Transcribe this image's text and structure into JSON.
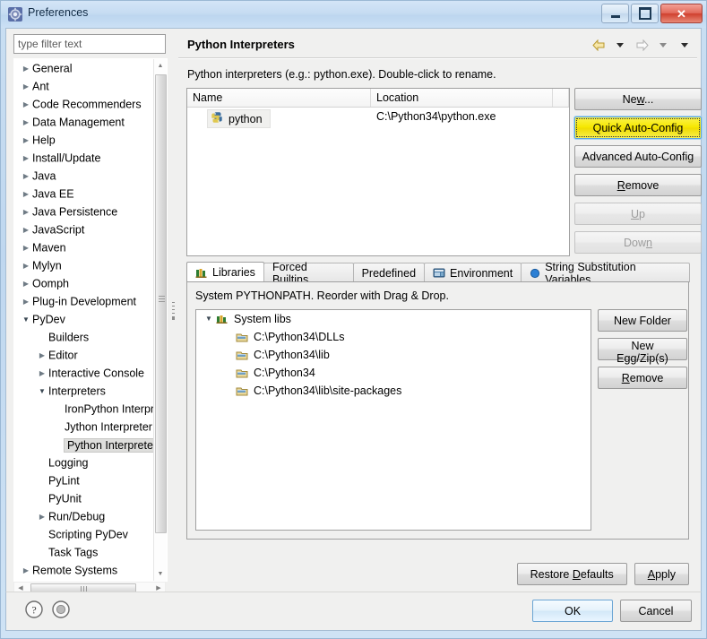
{
  "window": {
    "title": "Preferences",
    "icon": "preferences-gear-icon",
    "controls": {
      "minimize": "minimize-button",
      "maximize": "maximize-button",
      "close": "✕"
    }
  },
  "sidebar": {
    "filter": {
      "placeholder": "type filter text",
      "value": ""
    },
    "items": [
      {
        "label": "General",
        "indent": 0,
        "arrow": "collapsed",
        "selected": false
      },
      {
        "label": "Ant",
        "indent": 0,
        "arrow": "collapsed",
        "selected": false
      },
      {
        "label": "Code Recommenders",
        "indent": 0,
        "arrow": "collapsed",
        "selected": false
      },
      {
        "label": "Data Management",
        "indent": 0,
        "arrow": "collapsed",
        "selected": false
      },
      {
        "label": "Help",
        "indent": 0,
        "arrow": "collapsed",
        "selected": false
      },
      {
        "label": "Install/Update",
        "indent": 0,
        "arrow": "collapsed",
        "selected": false
      },
      {
        "label": "Java",
        "indent": 0,
        "arrow": "collapsed",
        "selected": false
      },
      {
        "label": "Java EE",
        "indent": 0,
        "arrow": "collapsed",
        "selected": false
      },
      {
        "label": "Java Persistence",
        "indent": 0,
        "arrow": "collapsed",
        "selected": false
      },
      {
        "label": "JavaScript",
        "indent": 0,
        "arrow": "collapsed",
        "selected": false
      },
      {
        "label": "Maven",
        "indent": 0,
        "arrow": "collapsed",
        "selected": false
      },
      {
        "label": "Mylyn",
        "indent": 0,
        "arrow": "collapsed",
        "selected": false
      },
      {
        "label": "Oomph",
        "indent": 0,
        "arrow": "collapsed",
        "selected": false
      },
      {
        "label": "Plug-in Development",
        "indent": 0,
        "arrow": "collapsed",
        "selected": false
      },
      {
        "label": "PyDev",
        "indent": 0,
        "arrow": "expanded",
        "selected": false
      },
      {
        "label": "Builders",
        "indent": 1,
        "arrow": "none",
        "selected": false
      },
      {
        "label": "Editor",
        "indent": 1,
        "arrow": "collapsed",
        "selected": false
      },
      {
        "label": "Interactive Console",
        "indent": 1,
        "arrow": "collapsed",
        "selected": false
      },
      {
        "label": "Interpreters",
        "indent": 1,
        "arrow": "expanded",
        "selected": false
      },
      {
        "label": "IronPython Interpreter",
        "indent": 2,
        "arrow": "none",
        "selected": false
      },
      {
        "label": "Jython Interpreter",
        "indent": 2,
        "arrow": "none",
        "selected": false
      },
      {
        "label": "Python Interpreter",
        "indent": 2,
        "arrow": "none",
        "selected": true
      },
      {
        "label": "Logging",
        "indent": 1,
        "arrow": "none",
        "selected": false
      },
      {
        "label": "PyLint",
        "indent": 1,
        "arrow": "none",
        "selected": false
      },
      {
        "label": "PyUnit",
        "indent": 1,
        "arrow": "none",
        "selected": false
      },
      {
        "label": "Run/Debug",
        "indent": 1,
        "arrow": "collapsed",
        "selected": false
      },
      {
        "label": "Scripting PyDev",
        "indent": 1,
        "arrow": "none",
        "selected": false
      },
      {
        "label": "Task Tags",
        "indent": 1,
        "arrow": "none",
        "selected": false
      },
      {
        "label": "Remote Systems",
        "indent": 0,
        "arrow": "collapsed",
        "selected": false
      }
    ]
  },
  "page": {
    "title": "Python Interpreters",
    "description": "Python interpreters (e.g.: python.exe).   Double-click to rename.",
    "nav": {
      "back": "back-arrow-icon",
      "back_menu": "chevron-down-icon",
      "forward": "forward-arrow-icon",
      "forward_menu": "chevron-down-icon",
      "more_menu": "chevron-down-icon"
    }
  },
  "interpreter_table": {
    "columns": [
      "Name",
      "Location"
    ],
    "rows": [
      {
        "icon": "python-icon",
        "name": "python",
        "location": "C:\\Python34\\python.exe"
      }
    ]
  },
  "interpreter_buttons": [
    {
      "label": "New...",
      "accesskey": "w",
      "state": "normal"
    },
    {
      "label": "Quick Auto-Config",
      "accesskey": "",
      "state": "highlight"
    },
    {
      "label": "Advanced Auto-Config",
      "accesskey": "",
      "state": "normal"
    },
    {
      "label": "Remove",
      "accesskey": "R",
      "state": "normal"
    },
    {
      "label": "Up",
      "accesskey": "U",
      "state": "disabled"
    },
    {
      "label": "Down",
      "accesskey": "n",
      "state": "disabled"
    }
  ],
  "tabs": [
    {
      "label": "Libraries",
      "icon": "libraries-icon",
      "active": true
    },
    {
      "label": "Forced Builtins",
      "icon": "",
      "active": false
    },
    {
      "label": "Predefined",
      "icon": "",
      "active": false
    },
    {
      "label": "Environment",
      "icon": "environment-icon",
      "active": false
    },
    {
      "label": "String Substitution Variables",
      "icon": "blue-dot-icon",
      "active": false
    }
  ],
  "libraries": {
    "note": "System PYTHONPATH.  Reorder with Drag & Drop.",
    "tree": [
      {
        "label": "System libs",
        "indent": 0,
        "arrow": "expanded",
        "icon": "libraries-icon"
      },
      {
        "label": "C:\\Python34\\DLLs",
        "indent": 1,
        "arrow": "none",
        "icon": "folder-lib-icon"
      },
      {
        "label": "C:\\Python34\\lib",
        "indent": 1,
        "arrow": "none",
        "icon": "folder-lib-icon"
      },
      {
        "label": "C:\\Python34",
        "indent": 1,
        "arrow": "none",
        "icon": "folder-lib-icon"
      },
      {
        "label": "C:\\Python34\\lib\\site-packages",
        "indent": 1,
        "arrow": "none",
        "icon": "folder-lib-icon"
      }
    ],
    "buttons": [
      {
        "label": "New Folder",
        "accesskey": ""
      },
      {
        "label": "New Egg/Zip(s)",
        "accesskey": ""
      },
      {
        "label": "Remove",
        "accesskey": "R"
      }
    ]
  },
  "page_buttons": [
    {
      "label": "Restore Defaults",
      "accesskey": "D"
    },
    {
      "label": "Apply",
      "accesskey": "A"
    }
  ],
  "footer": {
    "help_icon": "help-question-icon",
    "record_icon": "record-circle-icon",
    "ok": "OK",
    "cancel": "Cancel"
  },
  "colors": {
    "highlight_button": "#f6e800",
    "title_bar": "#c6dcf2",
    "close_button": "#cf3f2d",
    "dialog_bg": "#f0f0ef",
    "ok_border": "#6ba5d4"
  }
}
